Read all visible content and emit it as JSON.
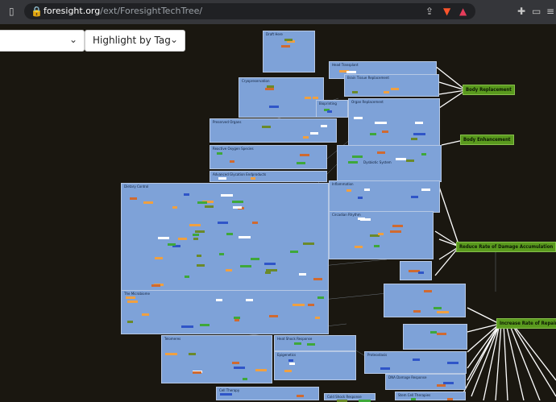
{
  "browser": {
    "url_domain": "foresight.org",
    "url_path": "/ext/ForesightTechTree/"
  },
  "controls": {
    "highlight_label": "Highlight by Tag"
  },
  "nodes": [
    {
      "label": "Draft Here"
    },
    {
      "label": "Head Transplant"
    },
    {
      "label": "Brain Tissue Replacement"
    },
    {
      "label": "Cryopreservation"
    },
    {
      "label": "Bioprinting"
    },
    {
      "label": "Organ Replacement"
    },
    {
      "label": "Preserved Organs"
    },
    {
      "label": "Reactive Oxygen Species"
    },
    {
      "label": "Advanced Glycation Endproducts"
    },
    {
      "label": "Dysbiotic System"
    },
    {
      "label": "Dietary Control"
    },
    {
      "label": "Inflammation"
    },
    {
      "label": "Circadian Rhythm"
    },
    {
      "label": "The Microbiome"
    },
    {
      "label": "Telomeres"
    },
    {
      "label": "Heat Shock Response"
    },
    {
      "label": "Epigenetics"
    },
    {
      "label": "Proteostasis"
    },
    {
      "label": "DNA Damage Response"
    },
    {
      "label": "Cell Therapy"
    },
    {
      "label": "Cold Shock Response"
    },
    {
      "label": "Stem Cell Therapies"
    }
  ],
  "goals": [
    {
      "label": "Body Replacement"
    },
    {
      "label": "Body Enhancement"
    },
    {
      "label": "Reduce Rate of Damage Accumulation"
    },
    {
      "label": "Increase Rate of Repair"
    }
  ]
}
